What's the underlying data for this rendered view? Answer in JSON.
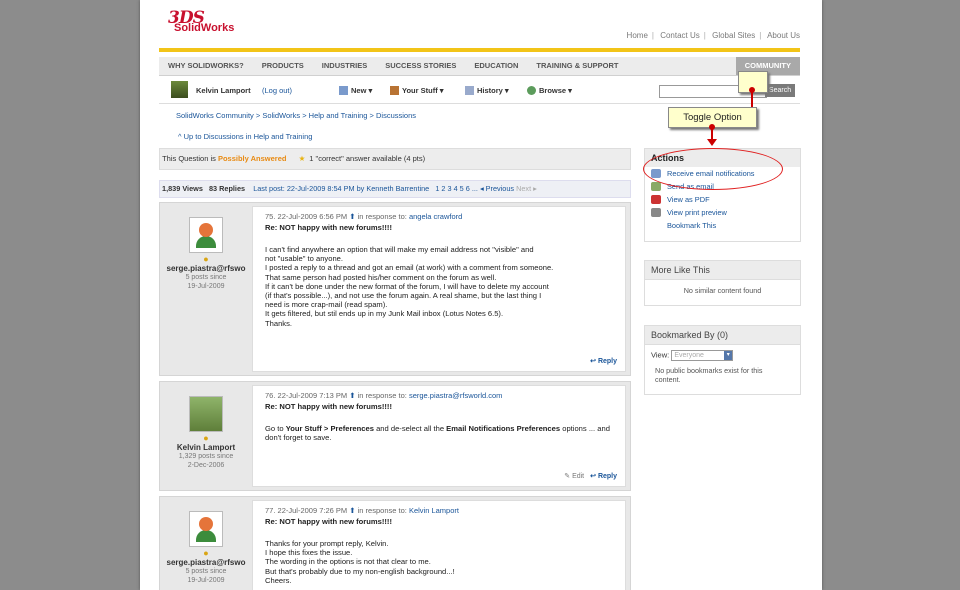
{
  "header": {
    "logo_mark": "3DS",
    "logo_text": "SolidWorks",
    "top_links": [
      "Home",
      "Contact Us",
      "Global Sites",
      "About Us"
    ]
  },
  "nav": {
    "items": [
      "WHY SOLIDWORKS?",
      "PRODUCTS",
      "INDUSTRIES",
      "SUCCESS STORIES",
      "EDUCATION",
      "TRAINING & SUPPORT"
    ],
    "active": "COMMUNITY"
  },
  "userbar": {
    "username": "Kelvin Lamport",
    "logout": "(Log out)",
    "menus": [
      "New",
      "Your Stuff",
      "History",
      "Browse"
    ],
    "search_button": "Search"
  },
  "breadcrumb": "SolidWorks Community > SolidWorks > Help and Training > Discussions",
  "up_link": "^ Up to Discussions in Help and Training",
  "question": {
    "prefix": "This Question is",
    "status": "Possibly Answered",
    "correct": "1 \"correct\" answer available (4 pts)"
  },
  "stats": {
    "views": "1,839 Views",
    "replies": "83 Replies",
    "last_post": "Last post: 22-Jul-2009 8:54 PM by Kenneth Barrentine",
    "pages": "1 2 3 4 5 6 ...",
    "previous": "Previous",
    "next": "Next"
  },
  "posts": [
    {
      "author": "serge.piastra@rfswo",
      "meta1": "5 posts since",
      "meta2": "19-Jul-2009",
      "num": "75.",
      "date": "22-Jul-2009 6:56 PM",
      "in_response": "in response to:",
      "to": "angela crawford",
      "subject": "Re: NOT happy with new forums!!!!",
      "text": "I can't find anywhere an option that will make my email address not \"visible\" and\nnot \"usable\" to anyone.\nI posted a reply to a thread and got an email (at work) with a comment from someone.\nThat same person had posted his/her comment on the forum as well.\nIf it can't be done under the new format of the forum, I will have to delete my account\n(if that's possible...), and not use the forum again. A real shame, but the last thing I\nneed is more crap-mail (read spam).\nIt gets filtered, but stil ends up in my Junk Mail inbox (Lotus Notes 6.5).\nThanks.",
      "reply": "Reply"
    },
    {
      "author": "Kelvin Lamport",
      "meta1": "1,329 posts since",
      "meta2": "2-Dec-2006",
      "num": "76.",
      "date": "22-Jul-2009 7:13 PM",
      "in_response": "in response to:",
      "to": "serge.piastra@rfsworld.com",
      "subject": "Re: NOT happy with new forums!!!!",
      "text_a": "Go to ",
      "text_b": "Your Stuff > Preferences",
      "text_c": " and de-select all the ",
      "text_d": "Email Notifications Preferences",
      "text_e": " options ... and don't forget to save.",
      "edit": "Edit",
      "reply": "Reply"
    },
    {
      "author": "serge.piastra@rfswo",
      "meta1": "5 posts since",
      "meta2": "19-Jul-2009",
      "num": "77.",
      "date": "22-Jul-2009 7:26 PM",
      "in_response": "in response to:",
      "to": "Kelvin Lamport",
      "subject": "Re: NOT happy with new forums!!!!",
      "text": "Thanks for your prompt reply, Kelvin.\nI hope this fixes the issue.\nThe wording in the options is not that clear to me.\nBut that's probably due to my non-english background...!\nCheers."
    }
  ],
  "sidebar": {
    "actions_title": "Actions",
    "actions": [
      "Receive email notifications",
      "Send as email",
      "View as PDF",
      "View print preview",
      "Bookmark This"
    ],
    "more_like_title": "More Like This",
    "more_like_msg": "No similar content found",
    "bookmarked_title": "Bookmarked By (0)",
    "view_label": "View:",
    "view_value": "Everyone",
    "bookmarked_msg": "No public bookmarks exist for this content."
  },
  "annotation": {
    "tooltip": "Toggle Option"
  }
}
